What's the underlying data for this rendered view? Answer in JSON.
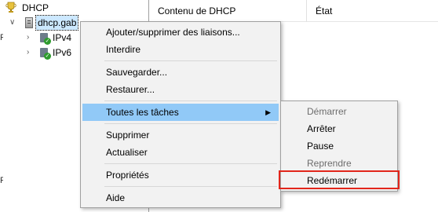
{
  "tree": {
    "root_label": "DHCP",
    "server_label": "dhcp.gab",
    "ipv4_label": "IPv4",
    "ipv6_label": "IPv6",
    "edge_glyphs": [
      "R",
      "F"
    ]
  },
  "list": {
    "columns": [
      "Contenu de DHCP",
      "État"
    ]
  },
  "context_menu": {
    "items": [
      "Ajouter/supprimer des liaisons...",
      "Interdire",
      "Sauvegarder...",
      "Restaurer...",
      "Toutes les tâches",
      "Supprimer",
      "Actualiser",
      "Propriétés",
      "Aide"
    ],
    "highlighted": "Toutes les tâches"
  },
  "submenu": {
    "items": [
      {
        "label": "Démarrer",
        "enabled": false
      },
      {
        "label": "Arrêter",
        "enabled": true
      },
      {
        "label": "Pause",
        "enabled": true
      },
      {
        "label": "Reprendre",
        "enabled": false
      },
      {
        "label": "Redémarrer",
        "enabled": true
      }
    ],
    "emphasized": "Redémarrer",
    "emphasis_color": "#e2261b"
  },
  "colors": {
    "menu_highlight": "#91c9f7",
    "selection": "#cce8ff"
  }
}
